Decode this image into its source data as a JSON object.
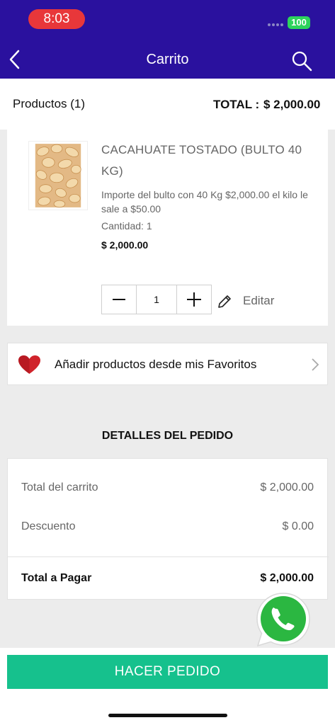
{
  "status_bar": {
    "time": "8:03",
    "battery": "100"
  },
  "header": {
    "title": "Carrito",
    "back_icon": "chevron-left-icon",
    "search_icon": "search-icon"
  },
  "summary": {
    "products_label": "Productos (1)",
    "total_label": "TOTAL :",
    "total_value": "$ 2,000.00"
  },
  "product": {
    "name": "CACAHUATE TOSTADO (BULTO 40 KG)",
    "description": "Importe del bulto con 40 Kg  $2,000.00  el kilo le sale a $50.00",
    "quantity_text": "Cantidad:  1",
    "price": "$ 2,000.00",
    "stepper_value": "1",
    "edit_label": "Editar"
  },
  "favorites": {
    "label": "Añadir productos desde mis Favoritos",
    "icon": "heart-icon"
  },
  "details": {
    "title": "DETALLES DEL PEDIDO",
    "cart_total_label": "Total del carrito",
    "cart_total_value": "$ 2,000.00",
    "discount_label": "Descuento",
    "discount_value": "$ 0.00",
    "pay_total_label": "Total a Pagar",
    "pay_total_value": "$ 2,000.00"
  },
  "footer": {
    "order_button": "HACER PEDIDO"
  },
  "colors": {
    "header": "#2a119e",
    "accent_green": "#16c18d",
    "time_pill": "#e8373a",
    "heart": "#d0232b",
    "whatsapp": "#2bb741"
  }
}
